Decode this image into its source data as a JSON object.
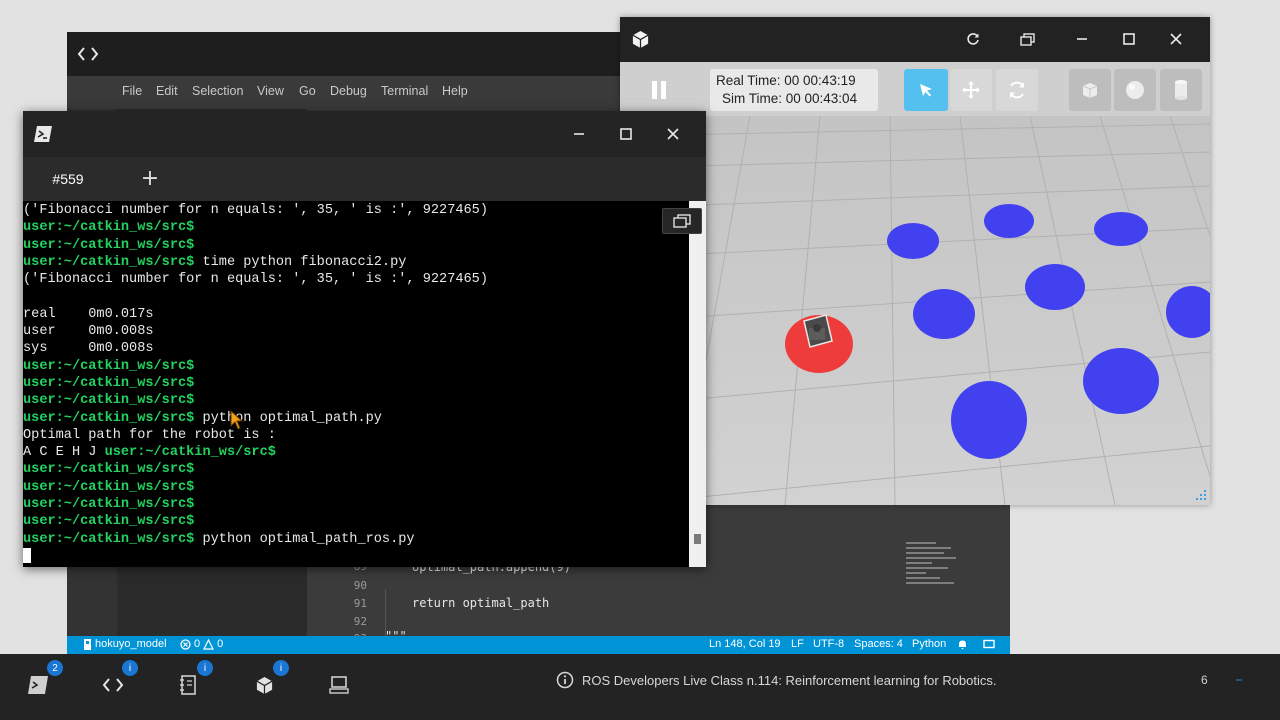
{
  "editor": {
    "menu": [
      "File",
      "Edit",
      "Selection",
      "View",
      "Go",
      "Debug",
      "Terminal",
      "Help"
    ],
    "code_lines": [
      {
        "num": "89",
        "text": "optimal_path.append(9)"
      },
      {
        "num": "90",
        "text": ""
      },
      {
        "num": "91",
        "text": "return optimal_path"
      },
      {
        "num": "92",
        "text": ""
      },
      {
        "num": "93",
        "text": "\"\"\""
      }
    ],
    "status": {
      "branch": "hokuyo_model",
      "errors": "0",
      "warnings": "0",
      "position": "Ln 148, Col 19",
      "eol": "LF",
      "encoding": "UTF-8",
      "spaces": "Spaces: 4",
      "language": "Python"
    }
  },
  "gazebo": {
    "real_time": "Real Time: 00 00:43:19",
    "sim_time": "Sim Time: 00 00:43:04",
    "colors": {
      "obstacle": "#4141f0",
      "goal": "#ee3b3b",
      "accent": "#53c0f0"
    }
  },
  "terminal": {
    "tab_label": "#559",
    "new_tab": "+",
    "prompt": "user:~/catkin_ws/src$",
    "lines": [
      {
        "prompt": "",
        "text": "('Fibonacci number for n equals: ', 35, ' is :', 9227465)"
      },
      {
        "prompt": "user:~/catkin_ws/src$",
        "text": ""
      },
      {
        "prompt": "user:~/catkin_ws/src$",
        "text": ""
      },
      {
        "prompt": "user:~/catkin_ws/src$",
        "text": " time python fibonacci2.py"
      },
      {
        "prompt": "",
        "text": "('Fibonacci number for n equals: ', 35, ' is :', 9227465)"
      },
      {
        "prompt": "",
        "text": ""
      },
      {
        "prompt": "",
        "text": "real    0m0.017s"
      },
      {
        "prompt": "",
        "text": "user    0m0.008s"
      },
      {
        "prompt": "",
        "text": "sys     0m0.008s"
      },
      {
        "prompt": "user:~/catkin_ws/src$",
        "text": ""
      },
      {
        "prompt": "user:~/catkin_ws/src$",
        "text": ""
      },
      {
        "prompt": "user:~/catkin_ws/src$",
        "text": ""
      },
      {
        "prompt": "user:~/catkin_ws/src$",
        "text": " python optimal_path.py"
      },
      {
        "prompt": "",
        "text": "Optimal path for the robot is :"
      },
      {
        "prompt": "user:~/catkin_ws/src$",
        "text": "",
        "prefix": "A C E H J "
      },
      {
        "prompt": "user:~/catkin_ws/src$",
        "text": ""
      },
      {
        "prompt": "user:~/catkin_ws/src$",
        "text": ""
      },
      {
        "prompt": "user:~/catkin_ws/src$",
        "text": ""
      },
      {
        "prompt": "user:~/catkin_ws/src$",
        "text": ""
      },
      {
        "prompt": "user:~/catkin_ws/src$",
        "text": " python optimal_path_ros.py"
      }
    ],
    "colors": {
      "prompt": "#23d160",
      "text": "#e8e8e8",
      "background": "#000000"
    }
  },
  "dock": {
    "badges": {
      "shell": "2",
      "editor": "i",
      "notebook": "i",
      "gazebo": "i"
    },
    "info_text": "ROS Developers Live Class n.114: Reinforcement learning for Robotics.",
    "page_number": "6"
  }
}
